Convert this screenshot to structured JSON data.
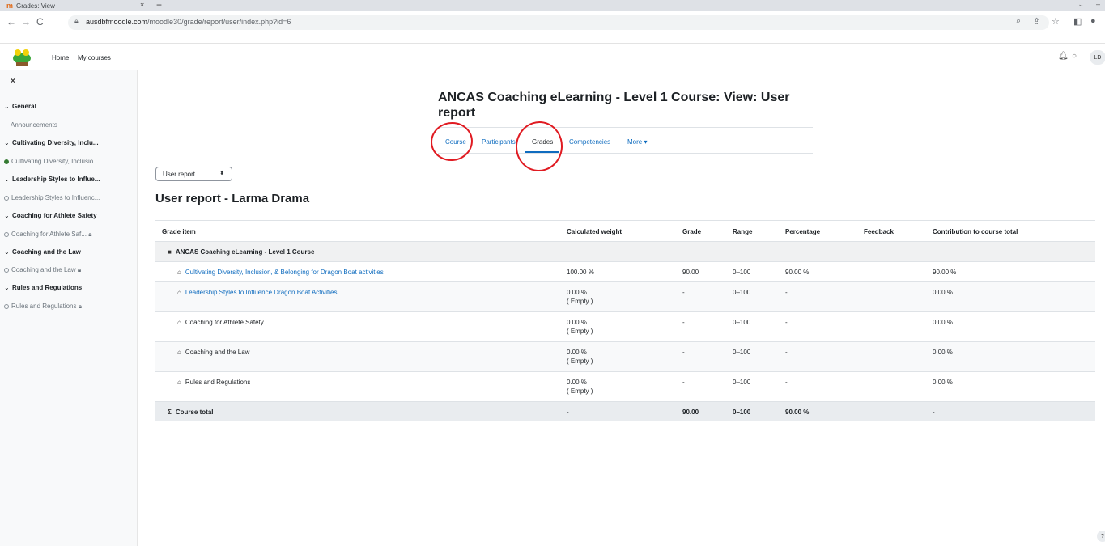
{
  "browser": {
    "tab_title": "Grades: View",
    "tab_favicon": "m",
    "url_host": "ausdbfmoodle.com",
    "url_path": "/moodle30/grade/report/user/index.php?id=6"
  },
  "navbar": {
    "home": "Home",
    "my_courses": "My courses",
    "avatar_initials": "LD"
  },
  "drawer": {
    "close_glyph": "×",
    "items": [
      {
        "type": "section",
        "label": "General"
      },
      {
        "type": "plain",
        "label": "Announcements"
      },
      {
        "type": "section",
        "label": "Cultivating Diversity, Inclu..."
      },
      {
        "type": "activity",
        "label": "Cultivating Diversity, Inclusio...",
        "state": "complete"
      },
      {
        "type": "section",
        "label": "Leadership Styles to Influe..."
      },
      {
        "type": "activity",
        "label": "Leadership Styles to Influenc...",
        "state": "open"
      },
      {
        "type": "section",
        "label": "Coaching for Athlete Safety"
      },
      {
        "type": "activity",
        "label": "Coaching for Athlete Saf...",
        "state": "locked"
      },
      {
        "type": "section",
        "label": "Coaching and the Law"
      },
      {
        "type": "activity",
        "label": "Coaching and the Law",
        "state": "locked"
      },
      {
        "type": "section",
        "label": "Rules and Regulations"
      },
      {
        "type": "activity",
        "label": "Rules and Regulations",
        "state": "locked"
      }
    ]
  },
  "page": {
    "title": "ANCAS Coaching eLearning - Level 1 Course: View: User report",
    "tabs": [
      "Course",
      "Participants",
      "Grades",
      "Competencies",
      "More ▾"
    ],
    "active_tab": "Grades",
    "report_select": "User report",
    "report_heading": "User report - Larma Drama"
  },
  "table": {
    "headers": [
      "Grade item",
      "Calculated weight",
      "Grade",
      "Range",
      "Percentage",
      "Feedback",
      "Contribution to course total"
    ],
    "category": "ANCAS Coaching eLearning - Level 1 Course",
    "rows": [
      {
        "item": "Cultivating Diversity, Inclusion, & Belonging for Dragon Boat activities",
        "link": true,
        "weight": "100.00 %",
        "weight_note": "",
        "grade": "90.00",
        "range": "0–100",
        "percentage": "90.00 %",
        "feedback": "",
        "contribution": "90.00 %"
      },
      {
        "item": "Leadership Styles to Influence Dragon Boat Activities",
        "link": true,
        "weight": "0.00 %",
        "weight_note": "( Empty )",
        "grade": "-",
        "range": "0–100",
        "percentage": "-",
        "feedback": "",
        "contribution": "0.00 %"
      },
      {
        "item": "Coaching for Athlete Safety",
        "link": false,
        "weight": "0.00 %",
        "weight_note": "( Empty )",
        "grade": "-",
        "range": "0–100",
        "percentage": "-",
        "feedback": "",
        "contribution": "0.00 %"
      },
      {
        "item": "Coaching and the Law",
        "link": false,
        "weight": "0.00 %",
        "weight_note": "( Empty )",
        "grade": "-",
        "range": "0–100",
        "percentage": "-",
        "feedback": "",
        "contribution": "0.00 %"
      },
      {
        "item": "Rules and Regulations",
        "link": false,
        "weight": "0.00 %",
        "weight_note": "( Empty )",
        "grade": "-",
        "range": "0–100",
        "percentage": "-",
        "feedback": "",
        "contribution": "0.00 %"
      }
    ],
    "total": {
      "label": "Course total",
      "weight": "-",
      "grade": "90.00",
      "range": "0–100",
      "percentage": "90.00 %",
      "feedback": "",
      "contribution": "-"
    }
  },
  "colors": {
    "link": "#0f6cbf",
    "annotation": "#e01b22",
    "complete": "#357a32"
  }
}
